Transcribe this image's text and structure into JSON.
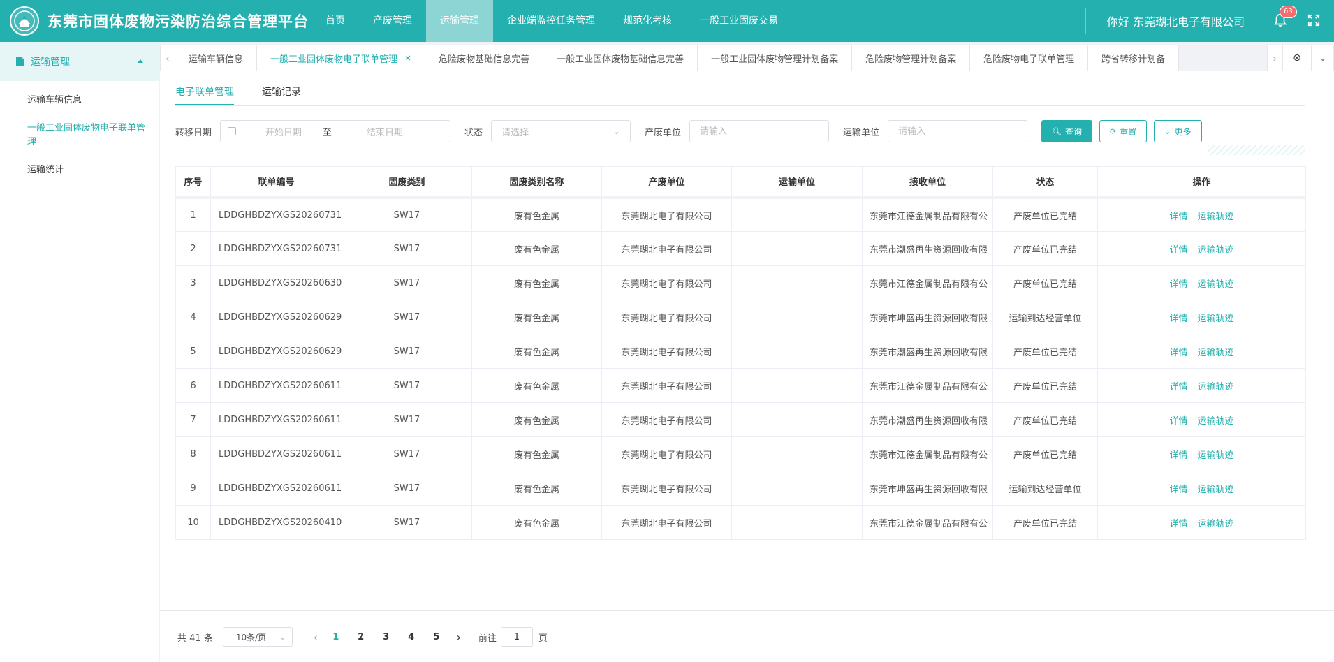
{
  "header": {
    "title": "东莞市固体废物污染防治综合管理平台",
    "nav": [
      {
        "label": "首页",
        "active": false
      },
      {
        "label": "产废管理",
        "active": false
      },
      {
        "label": "运输管理",
        "active": true
      },
      {
        "label": "企业端监控任务管理",
        "active": false
      },
      {
        "label": "规范化考核",
        "active": false
      },
      {
        "label": "一般工业固废交易",
        "active": false
      }
    ],
    "greeting": "你好 东莞瑚北电子有限公司",
    "notification_count": "63",
    "accent_color": "#24b0ae"
  },
  "sidebar": {
    "group_label": "运输管理",
    "items": [
      {
        "label": "运输车辆信息",
        "active": false
      },
      {
        "label": "一般工业固体废物电子联单管理",
        "active": true
      },
      {
        "label": "运输统计",
        "active": false
      }
    ]
  },
  "tabbar": {
    "tabs": [
      {
        "label": "运输车辆信息",
        "active": false
      },
      {
        "label": "一般工业固体废物电子联单管理",
        "active": true
      },
      {
        "label": "危险废物基础信息完善",
        "active": false
      },
      {
        "label": "一般工业固体废物基础信息完善",
        "active": false
      },
      {
        "label": "一般工业固体废物管理计划备案",
        "active": false
      },
      {
        "label": "危险废物管理计划备案",
        "active": false
      },
      {
        "label": "危险废物电子联单管理",
        "active": false
      },
      {
        "label": "跨省转移计划备",
        "active": false
      }
    ],
    "close_glyph": "×"
  },
  "subtabs": [
    {
      "label": "电子联单管理",
      "active": true
    },
    {
      "label": "运输记录",
      "active": false
    }
  ],
  "filters": {
    "date_label": "转移日期",
    "start_placeholder": "开始日期",
    "to_label": "至",
    "end_placeholder": "结束日期",
    "status_label": "状态",
    "status_placeholder": "请选择",
    "producer_label": "产废单位",
    "producer_placeholder": "请输入",
    "transporter_label": "运输单位",
    "transporter_placeholder": "请输入",
    "search_label": "查询",
    "reset_label": "重置",
    "more_label": "更多"
  },
  "table": {
    "columns": [
      "序号",
      "联单编号",
      "固废类别",
      "固废类别名称",
      "产废单位",
      "运输单位",
      "接收单位",
      "状态",
      "操作"
    ],
    "rows": [
      {
        "no": "1",
        "id": "LDDGHBDZYXGS20260731",
        "cat": "SW17",
        "cat_name": "废有色金属",
        "producer": "东莞瑚北电子有限公司",
        "transporter": "",
        "receiver": "东莞市江德金属制品有限有公",
        "status": "产废单位已完结"
      },
      {
        "no": "2",
        "id": "LDDGHBDZYXGS20260731",
        "cat": "SW17",
        "cat_name": "废有色金属",
        "producer": "东莞瑚北电子有限公司",
        "transporter": "",
        "receiver": "东莞市潮盛再生资源回收有限",
        "status": "产废单位已完结"
      },
      {
        "no": "3",
        "id": "LDDGHBDZYXGS20260630",
        "cat": "SW17",
        "cat_name": "废有色金属",
        "producer": "东莞瑚北电子有限公司",
        "transporter": "",
        "receiver": "东莞市江德金属制品有限有公",
        "status": "产废单位已完结"
      },
      {
        "no": "4",
        "id": "LDDGHBDZYXGS20260629",
        "cat": "SW17",
        "cat_name": "废有色金属",
        "producer": "东莞瑚北电子有限公司",
        "transporter": "",
        "receiver": "东莞市坤盛再生资源回收有限",
        "status": "运输到达经营单位"
      },
      {
        "no": "5",
        "id": "LDDGHBDZYXGS20260629",
        "cat": "SW17",
        "cat_name": "废有色金属",
        "producer": "东莞瑚北电子有限公司",
        "transporter": "",
        "receiver": "东莞市潮盛再生资源回收有限",
        "status": "产废单位已完结"
      },
      {
        "no": "6",
        "id": "LDDGHBDZYXGS20260611",
        "cat": "SW17",
        "cat_name": "废有色金属",
        "producer": "东莞瑚北电子有限公司",
        "transporter": "",
        "receiver": "东莞市江德金属制品有限有公",
        "status": "产废单位已完结"
      },
      {
        "no": "7",
        "id": "LDDGHBDZYXGS20260611",
        "cat": "SW17",
        "cat_name": "废有色金属",
        "producer": "东莞瑚北电子有限公司",
        "transporter": "",
        "receiver": "东莞市潮盛再生资源回收有限",
        "status": "产废单位已完结"
      },
      {
        "no": "8",
        "id": "LDDGHBDZYXGS20260611",
        "cat": "SW17",
        "cat_name": "废有色金属",
        "producer": "东莞瑚北电子有限公司",
        "transporter": "",
        "receiver": "东莞市江德金属制品有限有公",
        "status": "产废单位已完结"
      },
      {
        "no": "9",
        "id": "LDDGHBDZYXGS20260611",
        "cat": "SW17",
        "cat_name": "废有色金属",
        "producer": "东莞瑚北电子有限公司",
        "transporter": "",
        "receiver": "东莞市坤盛再生资源回收有限",
        "status": "运输到达经营单位"
      },
      {
        "no": "10",
        "id": "LDDGHBDZYXGS20260410",
        "cat": "SW17",
        "cat_name": "废有色金属",
        "producer": "东莞瑚北电子有限公司",
        "transporter": "",
        "receiver": "东莞市江德金属制品有限有公",
        "status": "产废单位已完结"
      }
    ],
    "action_detail": "详情",
    "action_track": "运输轨迹"
  },
  "pagination": {
    "total_text": "共 41 条",
    "page_size": "10条/页",
    "pages": [
      "1",
      "2",
      "3",
      "4",
      "5"
    ],
    "current_page": "1",
    "goto_prefix": "前往",
    "goto_value": "1",
    "goto_suffix": "页"
  }
}
